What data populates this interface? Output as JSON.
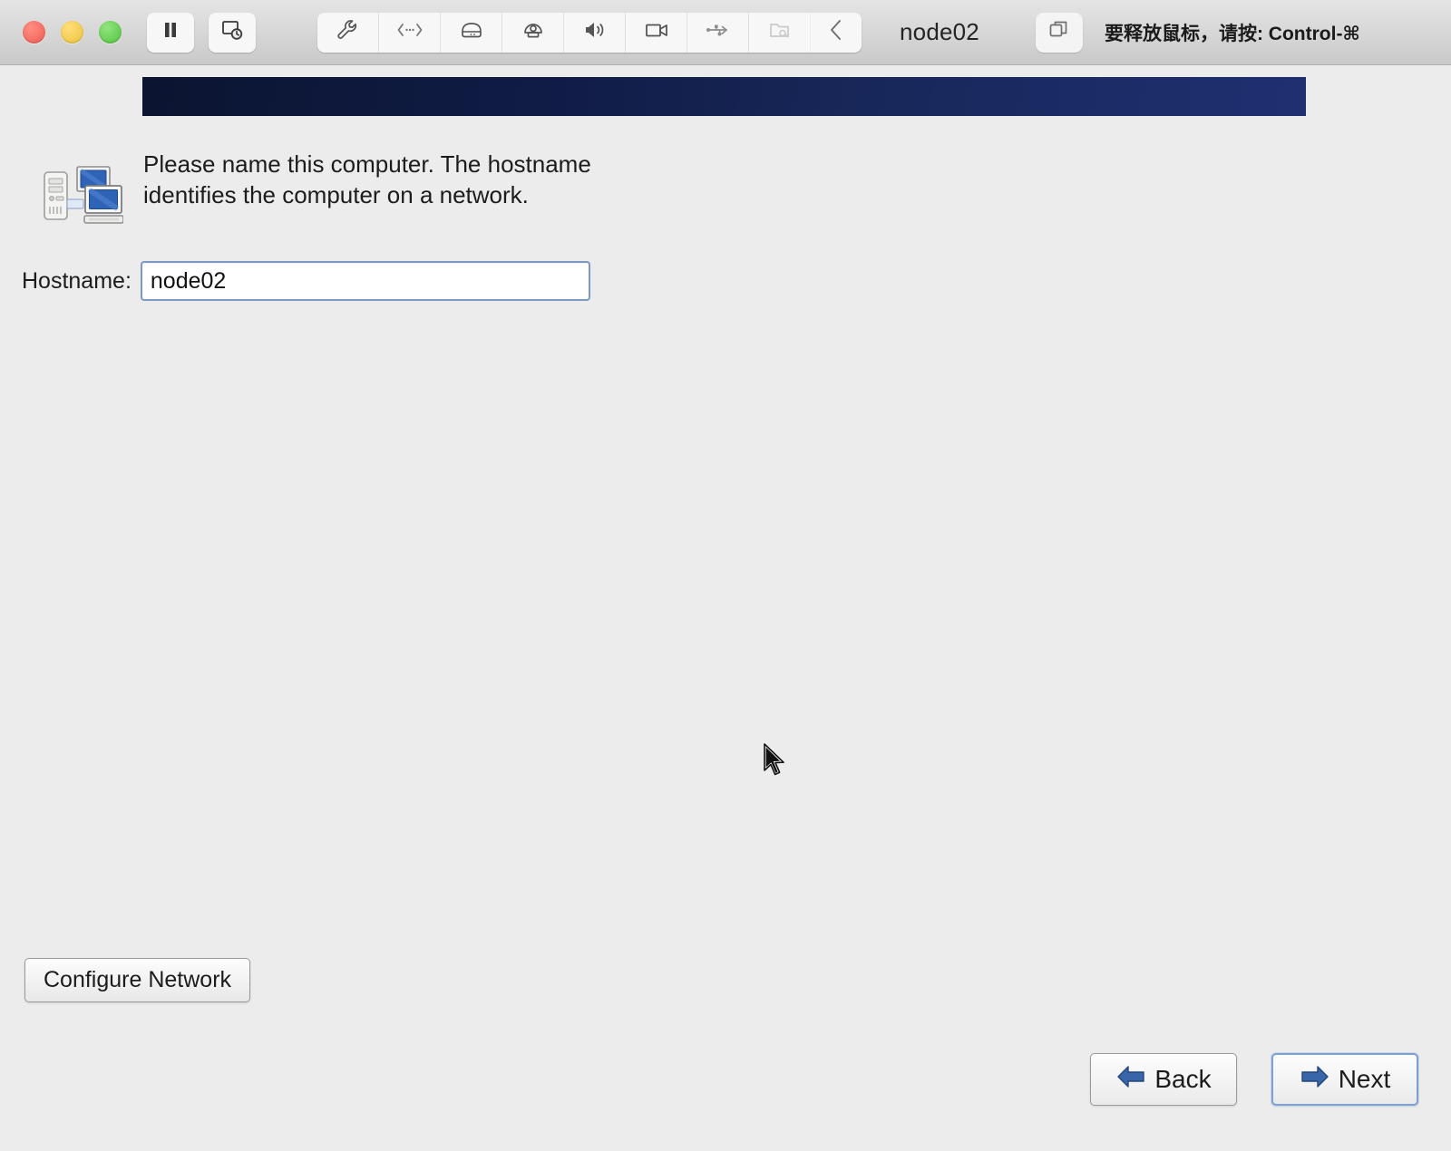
{
  "vm_toolbar": {
    "window_controls": [
      {
        "name": "close",
        "color": "#f05b50"
      },
      {
        "name": "minimize",
        "color": "#ebc13b"
      },
      {
        "name": "maximize",
        "color": "#51c13f"
      }
    ],
    "pause_button_label": "pause-icon",
    "snapshot_button_label": "snapshot-icon",
    "device_icons": [
      {
        "name": "settings-wrench-icon",
        "enabled": true
      },
      {
        "name": "network-icon",
        "enabled": true
      },
      {
        "name": "hard-drive-icon",
        "enabled": true
      },
      {
        "name": "webcam-icon",
        "enabled": true
      },
      {
        "name": "sound-icon",
        "enabled": true
      },
      {
        "name": "video-camera-icon",
        "enabled": true
      },
      {
        "name": "usb-icon",
        "enabled": true
      },
      {
        "name": "shared-folder-icon",
        "enabled": false
      },
      {
        "name": "chevron-left-icon",
        "enabled": true
      }
    ],
    "title": "node02",
    "fullscreen_button_label": "window-stack-icon",
    "release_hint": "要释放鼠标，请按: Control-⌘"
  },
  "installer": {
    "banner_color_start": "#0b1430",
    "banner_color_end": "#1e3071",
    "icon_name": "networked-computers-icon",
    "intro_text": "Please name this computer.  The hostname identifies the computer on a network.",
    "hostname_label": "Hostname:",
    "hostname_value": "node02",
    "hostname_placeholder": "",
    "configure_network_label": "Configure Network",
    "back_label": "Back",
    "next_label": "Next",
    "background_color": "#ececec"
  }
}
